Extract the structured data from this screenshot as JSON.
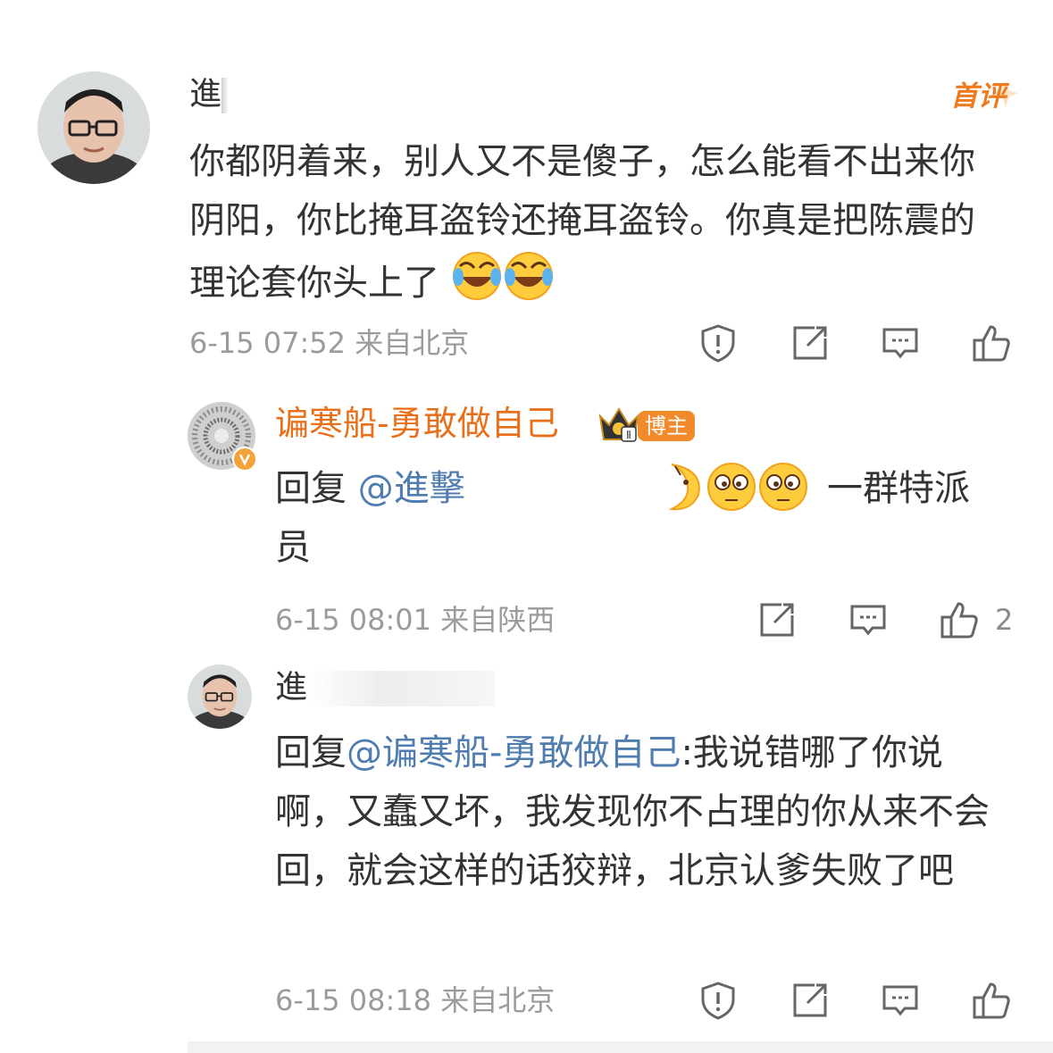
{
  "comment": {
    "author": "進",
    "badge": "首评",
    "text": "你都阴着来，别人又不是傻子，怎么能看不出来你阴阳，你比掩耳盗铃还掩耳盗铃。你真是把陈震的理论套你头上了",
    "emojis": [
      "laugh-cry-emoji",
      "laugh-cry-emoji"
    ],
    "date": "6-15 07:52",
    "location": "来自北京",
    "actions": [
      "report-icon",
      "repost-icon",
      "comment-icon",
      "like-icon"
    ]
  },
  "reply1": {
    "author": "谝寒船-勇敢做自己",
    "author_color": "#e8701a",
    "crown_level": "Ⅱ",
    "role_badge": "博主",
    "reply_prefix": "回复",
    "mention": "@進擊",
    "text_tail": "一群特派员",
    "date": "6-15 08:01",
    "location": "来自陕西",
    "like_count": "2"
  },
  "reply2": {
    "author": "進",
    "reply_prefix": "回复",
    "mention": "@谝寒船-勇敢做自己",
    "text": ":我说错哪了你说啊，又蠢又坏，我发现你不占理的你从来不会回，就会这样的话狡辩，北京认爹失败了吧",
    "date": "6-15 08:18",
    "location": "来自北京"
  },
  "colors": {
    "accent": "#e8701a",
    "mention": "#507daf",
    "meta": "#9b9b9b"
  }
}
